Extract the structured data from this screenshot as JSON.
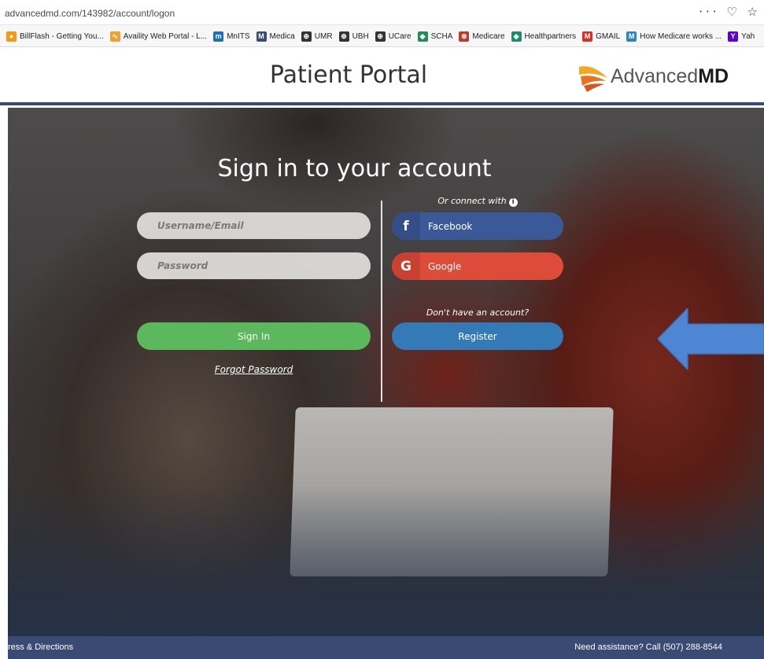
{
  "browser": {
    "url": "advancedmd.com/143982/account/logon",
    "actions": "··· ♡ ☆",
    "bookmarks": [
      {
        "label": "BillFlash - Getting You...",
        "icon": "billflash-icon",
        "color": "#f39c12",
        "glyph": "●"
      },
      {
        "label": "Availity Web Portal - L...",
        "icon": "availity-icon",
        "color": "#f0a030",
        "glyph": "∿"
      },
      {
        "label": "MnITS",
        "icon": "mnits-icon",
        "color": "#1a6fb5",
        "glyph": "m"
      },
      {
        "label": "Medica",
        "icon": "medica-icon",
        "color": "#3a4a73",
        "glyph": "M"
      },
      {
        "label": "UMR",
        "icon": "globe-icon",
        "color": "#333333",
        "glyph": "⊕"
      },
      {
        "label": "UBH",
        "icon": "globe-icon",
        "color": "#333333",
        "glyph": "⊕"
      },
      {
        "label": "UCare",
        "icon": "globe-icon",
        "color": "#333333",
        "glyph": "⊕"
      },
      {
        "label": "SCHA",
        "icon": "scha-icon",
        "color": "#1e8f5a",
        "glyph": "◆"
      },
      {
        "label": "Medicare",
        "icon": "medicare-icon",
        "color": "#c0392b",
        "glyph": "⊕"
      },
      {
        "label": "Healthpartners",
        "icon": "healthpartners-icon",
        "color": "#1c8b6b",
        "glyph": "◈"
      },
      {
        "label": "GMAIL",
        "icon": "gmail-icon",
        "color": "#d93025",
        "glyph": "M"
      },
      {
        "label": "How Medicare works ...",
        "icon": "medicare-works-icon",
        "color": "#2e86c1",
        "glyph": "M"
      },
      {
        "label": "Yah",
        "icon": "yahoo-icon",
        "color": "#6001d2",
        "glyph": "Y"
      }
    ]
  },
  "header": {
    "title": "Patient Portal",
    "logo_regular": "Advanced",
    "logo_bold": "MD",
    "accent": "#3a4a73"
  },
  "signin": {
    "title": "Sign in to your account",
    "username_placeholder": "Username/Email",
    "password_placeholder": "Password",
    "signin_label": "Sign In",
    "forgot_label": "Forgot Password",
    "connect_label": "Or connect with",
    "facebook_label": "Facebook",
    "google_label": "Google",
    "no_account_label": "Don't have an account?",
    "register_label": "Register",
    "colors": {
      "signin": "#5cb85c",
      "register": "#337ab7",
      "facebook": "#3b5998",
      "google": "#dd4b39",
      "arrow": "#4f86d4"
    }
  },
  "footer": {
    "left_text": "ress & Directions",
    "right_text": "Need assistance? Call (507) 288-8544"
  }
}
